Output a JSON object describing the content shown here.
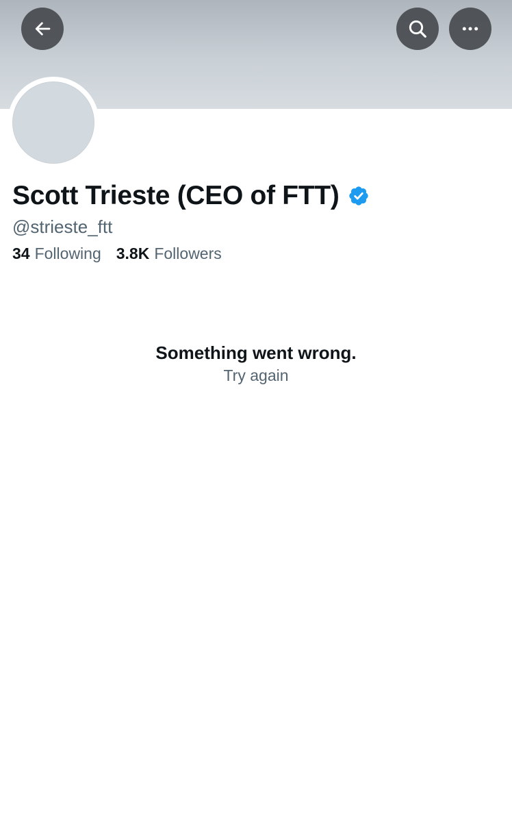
{
  "header": {
    "back_icon": "arrow-left-icon",
    "search_icon": "search-icon",
    "more_icon": "more-horizontal-icon",
    "banner_color": "#c9d0d6",
    "button_color": "#42464a"
  },
  "profile": {
    "display_name": "Scott Trieste (CEO of FTT)",
    "verified": true,
    "verified_icon": "verified-badge-icon",
    "verified_color": "#1d9bf0",
    "handle": "@strieste_ftt",
    "avatar_color": "#d3dadf",
    "following_count": "34",
    "following_label": "Following",
    "followers_count": "3.8K",
    "followers_label": "Followers"
  },
  "error": {
    "message": "Something went wrong.",
    "retry_label": "Try again"
  }
}
